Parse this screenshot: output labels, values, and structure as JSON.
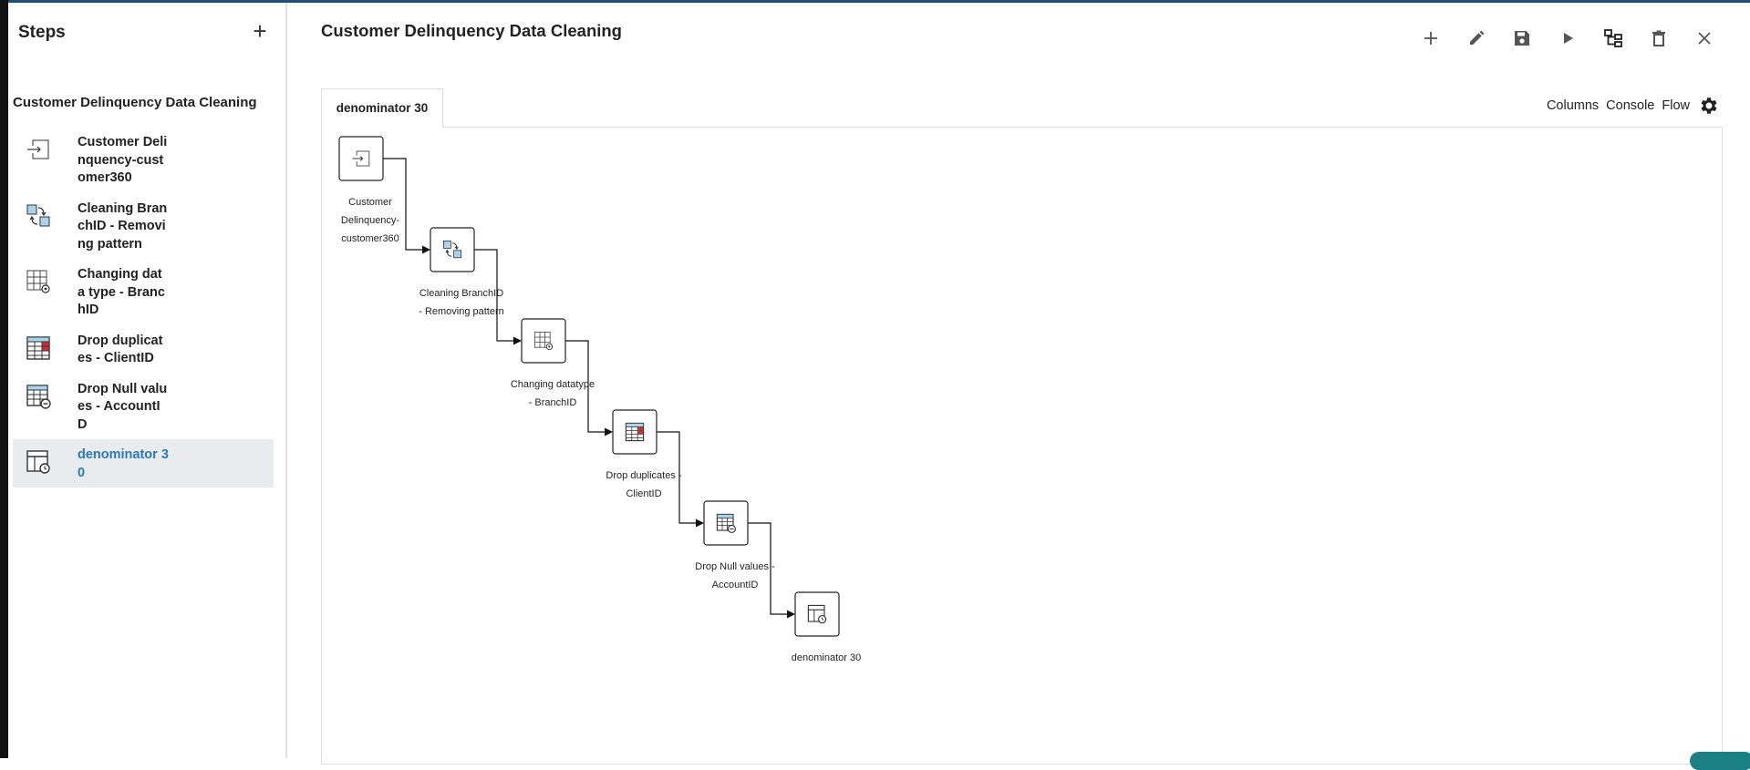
{
  "sidebar": {
    "title": "Steps",
    "add_label": "+",
    "flow_name": "Customer Delinquency Data Cleaning",
    "items": [
      {
        "label": "Customer Delinquency-customer360",
        "icon": "input-icon",
        "active": false
      },
      {
        "label": "Cleaning BranchID - Removing pattern",
        "icon": "transform-icon",
        "active": false
      },
      {
        "label": "Changing data type - BranchID",
        "icon": "grid-gear-icon",
        "active": false
      },
      {
        "label": "Drop duplicates - ClientID",
        "icon": "table-red-icon",
        "active": false
      },
      {
        "label": "Drop Null values - AccountID",
        "icon": "table-circle-icon",
        "active": false
      },
      {
        "label": "denominator 30",
        "icon": "output-table-icon",
        "active": true
      }
    ]
  },
  "header": {
    "title": "Customer Delinquency Data Cleaning",
    "toolbar": [
      "add-icon",
      "edit-icon",
      "save-icon",
      "run-icon",
      "tree-icon",
      "delete-icon",
      "close-icon"
    ]
  },
  "tab": {
    "label": "denominator 30"
  },
  "panel_links": {
    "columns": "Columns",
    "console": "Console",
    "flow": "Flow"
  },
  "canvas": {
    "nodes": [
      {
        "label_lines": [
          "Customer",
          "Delinquency-",
          "customer360"
        ],
        "icon": "input-icon"
      },
      {
        "label_lines": [
          "Cleaning BranchID",
          "- Removing pattern"
        ],
        "icon": "transform-icon"
      },
      {
        "label_lines": [
          "Changing datatype",
          "- BranchID"
        ],
        "icon": "grid-gear-icon"
      },
      {
        "label_lines": [
          "Drop duplicates -",
          "ClientID"
        ],
        "icon": "table-red-icon"
      },
      {
        "label_lines": [
          "Drop Null values -",
          "AccountID"
        ],
        "icon": "table-circle-icon"
      },
      {
        "label_lines": [
          "denominator 30"
        ],
        "icon": "output-table-icon"
      }
    ]
  },
  "colors": {
    "accent": "#2a7ab8",
    "active_bg": "#e9ebee",
    "icon_blue": "#a9d4ec",
    "icon_red": "#d03030"
  }
}
